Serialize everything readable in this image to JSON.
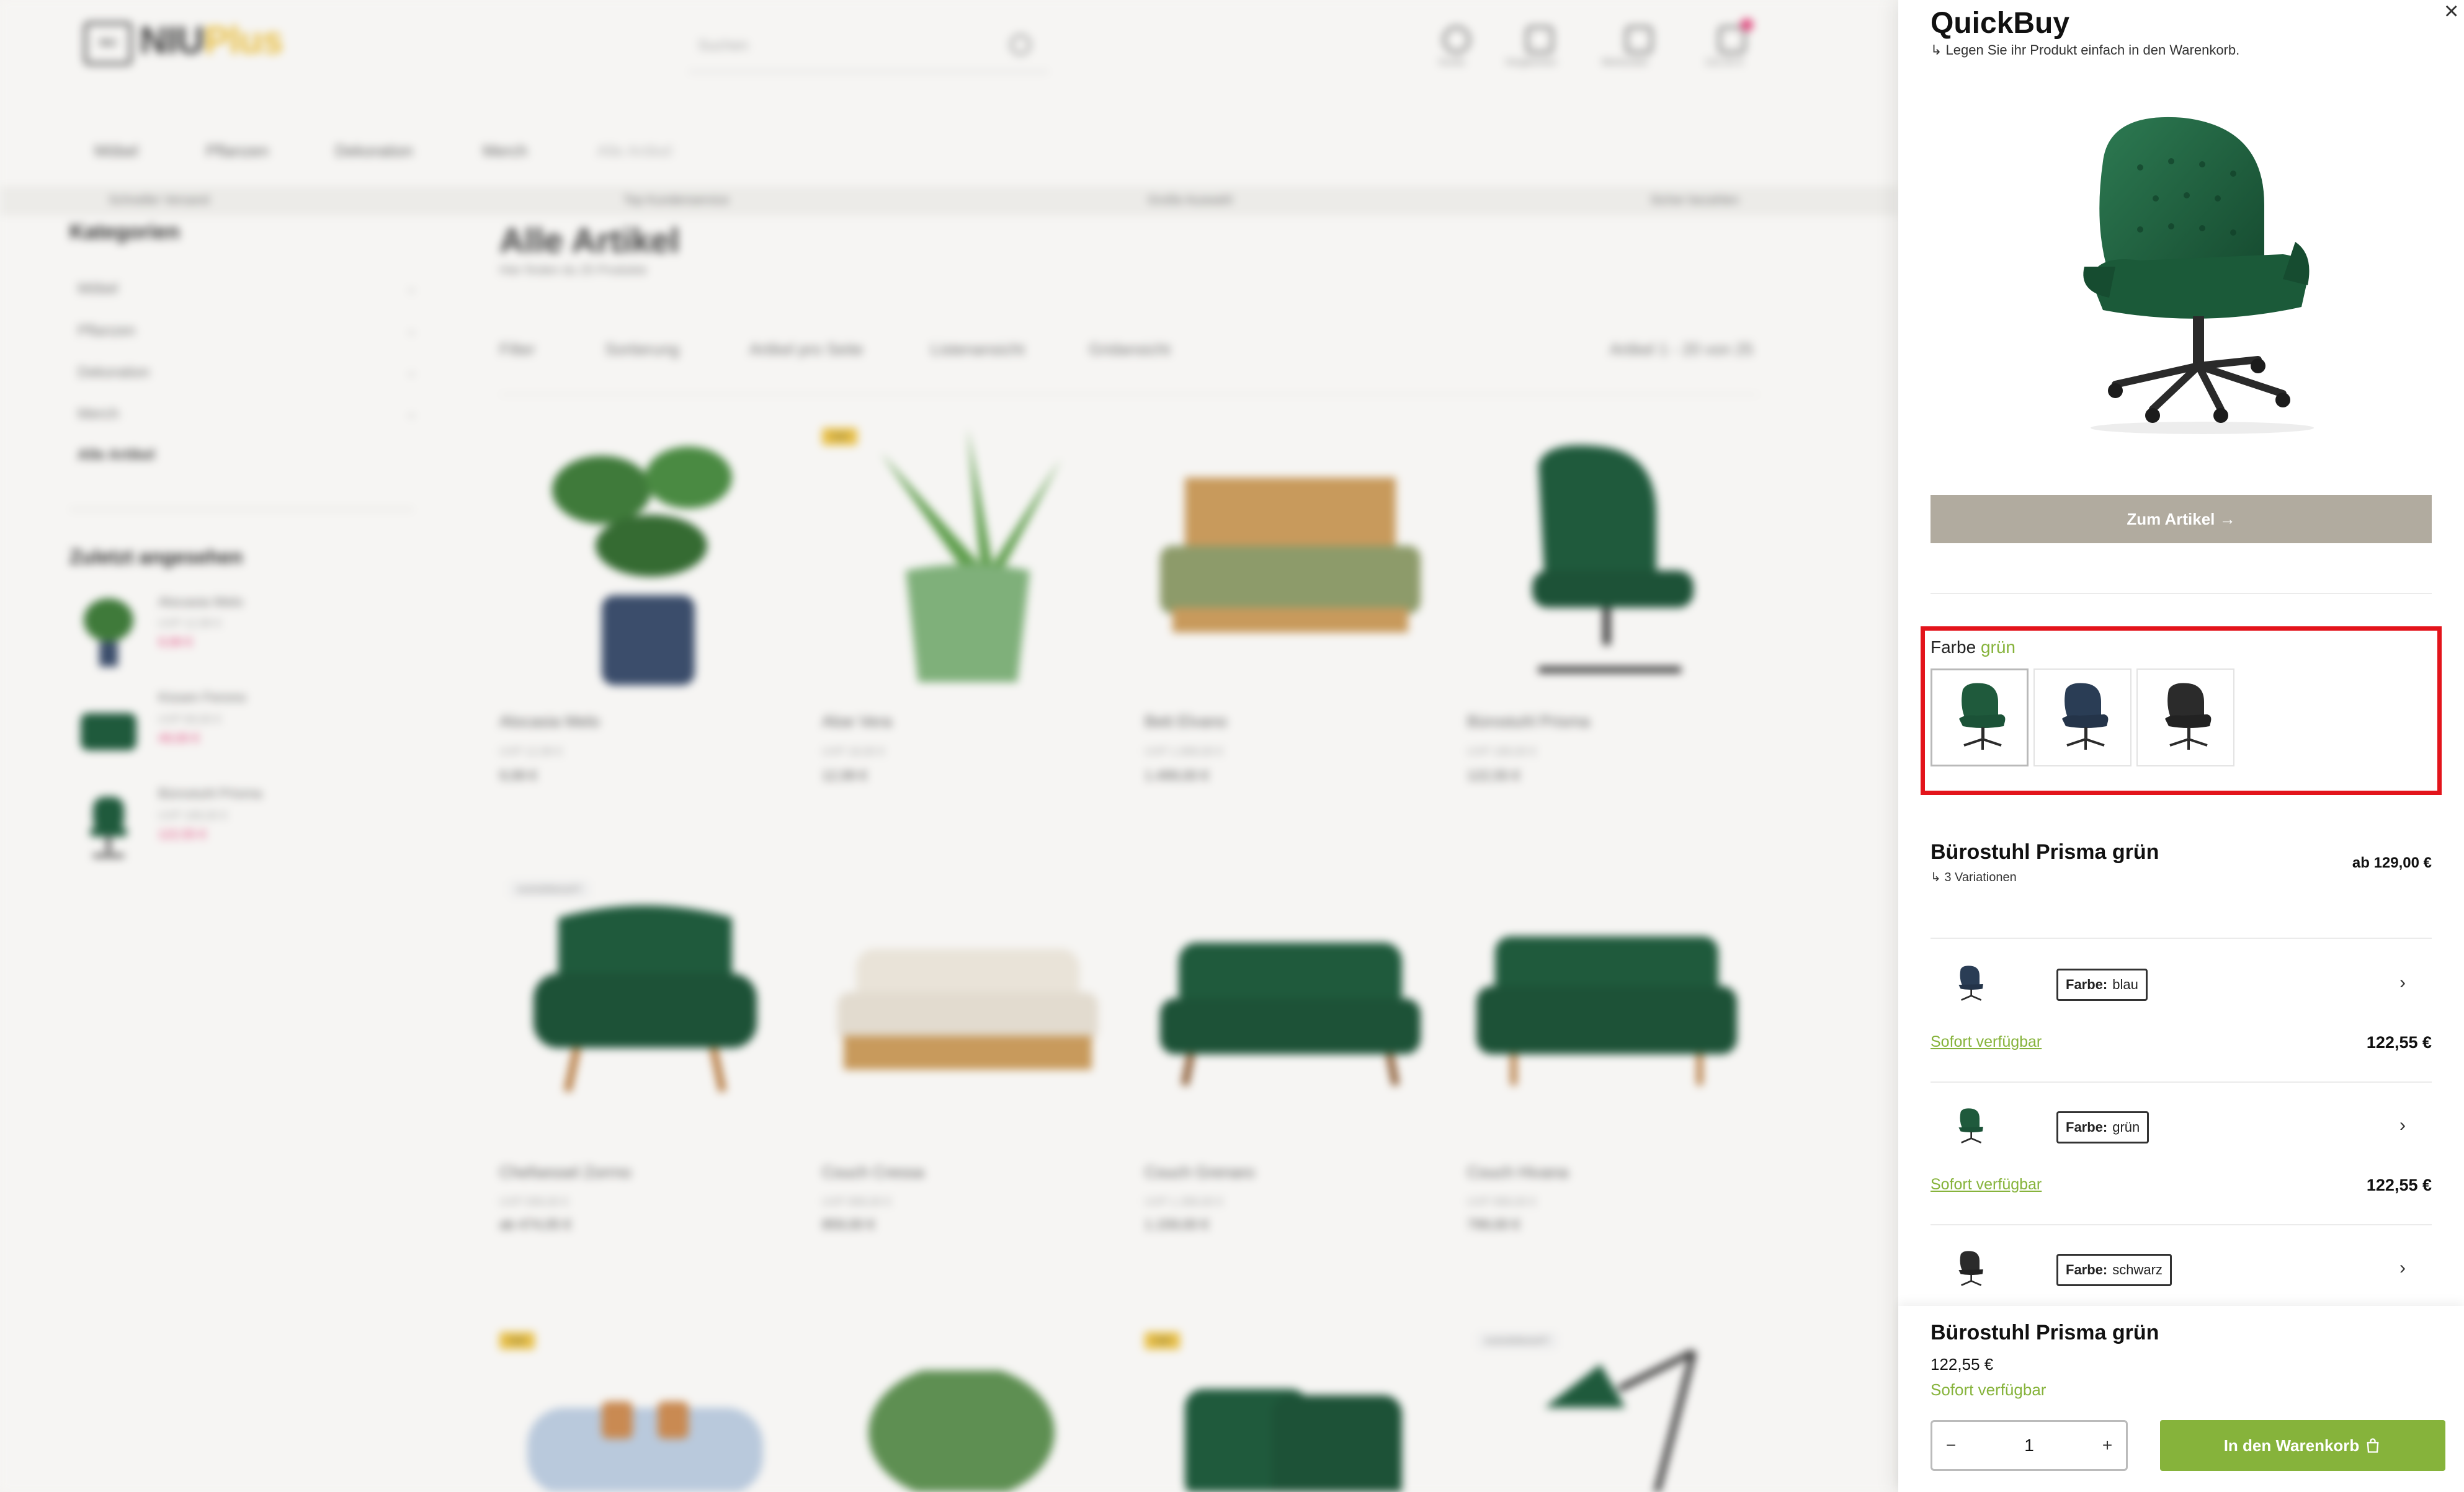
{
  "shop": {
    "logo_box": "NIU",
    "logo_name": "NIU",
    "logo_plus": "Plus",
    "search_placeholder": "Suchen",
    "header_icons": [
      {
        "label": "Konto",
        "icon": "user-icon"
      },
      {
        "label": "Vergleichen",
        "icon": "compare-icon"
      },
      {
        "label": "Merkzettel",
        "icon": "bookmark-icon"
      },
      {
        "label": "122,55 €",
        "icon": "cart-icon"
      }
    ],
    "nav": [
      "Möbel",
      "Pflanzen",
      "Dekoration",
      "Merch",
      "Alle Artikel"
    ],
    "usp": [
      "Schneller Versand",
      "Top Kundenservice",
      "Große Auswahl",
      "Sicher bezahlen"
    ],
    "sidebar": {
      "title": "Kategorien",
      "items": [
        "Möbel",
        "Pflanzen",
        "Dekoration",
        "Merch",
        "Alle Artikel"
      ],
      "recent_title": "Zuletzt angesehen",
      "recent": [
        {
          "name": "Alocasia Melo",
          "uvp": "UVP 12,99 €",
          "price": "9,99 €"
        },
        {
          "name": "Kissen Ferono",
          "uvp": "UVP 69,00 €",
          "price": "49,00 €"
        },
        {
          "name": "Bürostuhl Prisma",
          "uvp": "UVP 189,00 €",
          "price": "122,55 €"
        }
      ]
    },
    "page_title": "Alle Artikel",
    "page_sub": "Hier finden du 25 Produkte",
    "toolbar": [
      "Filter",
      "Sortierung",
      "Artikel pro Seite",
      "Listenansicht",
      "Gridansicht"
    ],
    "count": "Artikel 1 - 20 von 25",
    "products": [
      {
        "name": "Alocasia Melo",
        "uvp": "UVP 12,99 €",
        "price": "9,99 €",
        "badge": ""
      },
      {
        "name": "Aloe Vera",
        "uvp": "UVP 18,00 €",
        "price": "12,99 €",
        "badge": "TOP"
      },
      {
        "name": "Bett Elvano",
        "uvp": "UVP 1.899,00 €",
        "price": "1.499,00 €",
        "badge": ""
      },
      {
        "name": "Bürostuhl Prisma",
        "uvp": "UVP 189,00 €",
        "price": "122,55 €",
        "badge": ""
      },
      {
        "name": "Chefsessel Zorrno",
        "uvp": "UVP 599,00 €",
        "price": "ab 474,05 €",
        "badge": "AUSVERKAUFT"
      },
      {
        "name": "Couch Cressa",
        "uvp": "UVP 999,00 €",
        "price": "859,00 €",
        "badge": ""
      },
      {
        "name": "Couch Grenaro",
        "uvp": "UVP 1.399,00 €",
        "price": "1.159,00 €",
        "badge": ""
      },
      {
        "name": "Couch Hivana",
        "uvp": "UVP 999,00 €",
        "price": "799,00 €",
        "badge": ""
      }
    ],
    "row3_badges": [
      "TOP",
      "",
      "TOP",
      "AUSVERKAUFT"
    ]
  },
  "quickbuy": {
    "title": "QuickBuy",
    "subtitle": "Legen Sie ihr Produkt einfach in den Warenkorb.",
    "zum_artikel": "Zum Artikel",
    "farbe_label": "Farbe",
    "farbe_value": "grün",
    "swatches": [
      {
        "color": "#1f5a3c",
        "name": "grün"
      },
      {
        "color": "#2a3d55",
        "name": "blau"
      },
      {
        "color": "#2b2b2b",
        "name": "schwarz"
      }
    ],
    "product_title": "Bürostuhl Prisma grün",
    "variations": "3 Variationen",
    "from_price": "ab 129,00 €",
    "variants": [
      {
        "key": "Farbe:",
        "value": "blau",
        "stock": "Sofort verfügbar",
        "price": "122,55 €",
        "color": "#2a3d55"
      },
      {
        "key": "Farbe:",
        "value": "grün",
        "stock": "Sofort verfügbar",
        "price": "122,55 €",
        "color": "#1f5a3c"
      },
      {
        "key": "Farbe:",
        "value": "schwarz",
        "stock": "",
        "price": "",
        "color": "#2b2b2b"
      }
    ],
    "footer": {
      "title": "Bürostuhl Prisma grün",
      "price": "122,55 €",
      "stock": "Sofort verfügbar",
      "qty": "1",
      "minus": "−",
      "plus": "+",
      "cart": "In den Warenkorb"
    },
    "colors": {
      "accent": "#86b33b",
      "highlight": "#e3141b",
      "button": "#b1ab9f"
    }
  }
}
